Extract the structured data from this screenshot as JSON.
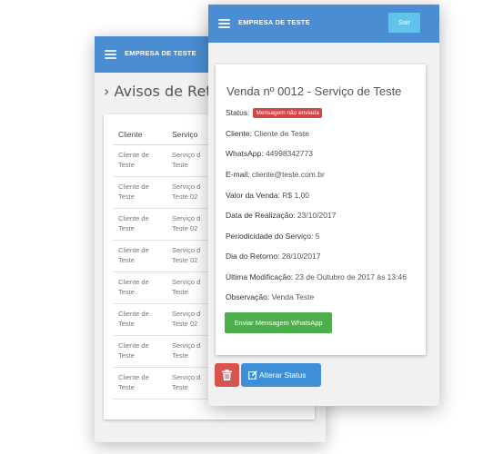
{
  "back_screen": {
    "navbar": {
      "brand": "EMPRESA DE TESTE",
      "menu_icon": "hamburger-icon"
    },
    "page_title": "› Avisos de Reto",
    "table": {
      "headers": [
        "Cliente",
        "Serviço"
      ],
      "rows": [
        [
          "Cliente de\nTeste",
          "Serviço d\nTeste"
        ],
        [
          "Cliente de\nTeste",
          "Serviço d\nTeste 02"
        ],
        [
          "Cliente de\nTeste",
          "Serviço d\nTeste 02"
        ],
        [
          "Cliente de\nTeste",
          "Serviço d\nTeste 02"
        ],
        [
          "Cliente de\nTeste",
          "Serviço d\nTeste"
        ],
        [
          "Cliente de\nTeste",
          "Serviço d\nTeste 02"
        ],
        [
          "Cliente de\nTeste",
          "Serviço d\nTeste"
        ],
        [
          "Cliente de\nTeste",
          "Serviço d\nTeste"
        ]
      ]
    }
  },
  "front_screen": {
    "navbar": {
      "brand": "EMPRESA DE TESTE",
      "menu_icon": "hamburger-icon",
      "logout_label": "Sair"
    },
    "card": {
      "title": "Venda nº 0012 - Serviço de Teste",
      "status_label": "Status:",
      "status_badge": "Mensagem não enviada",
      "cliente_label": "Cliente:",
      "cliente_value": "Cliente de Teste",
      "whatsapp_label": "WhatsApp:",
      "whatsapp_value": "44998342773",
      "email_label": "E-mail:",
      "email_value": "cliente@teste.com.br",
      "valor_label": "Valor da Venda:",
      "valor_value": "R$ 1,00",
      "realizacao_label": "Data de Realização:",
      "realizacao_value": "23/10/2017",
      "periodicidade_label": "Periodicidade do Serviço:",
      "periodicidade_value": "5",
      "retorno_label": "Dia do Retorno:",
      "retorno_value": "28/10/2017",
      "modificacao_label": "Última Modificação:",
      "modificacao_value": "23 de Outubro de 2017 às 13:46",
      "observacao_label": "Observação:",
      "observacao_value": "Venda Teste",
      "whatsapp_button": "Enviar Mensagem WhatsApp"
    },
    "actions": {
      "delete_icon": "trash-icon",
      "edit_icon": "edit-icon",
      "alterar_label": "Alterar Status"
    }
  },
  "colors": {
    "navbar": "#4a8dd2",
    "sair": "#5fc3ec",
    "badge": "#d64545",
    "whatsapp": "#4cae4c",
    "delete": "#d9534f",
    "alterar": "#3f8fd6"
  }
}
